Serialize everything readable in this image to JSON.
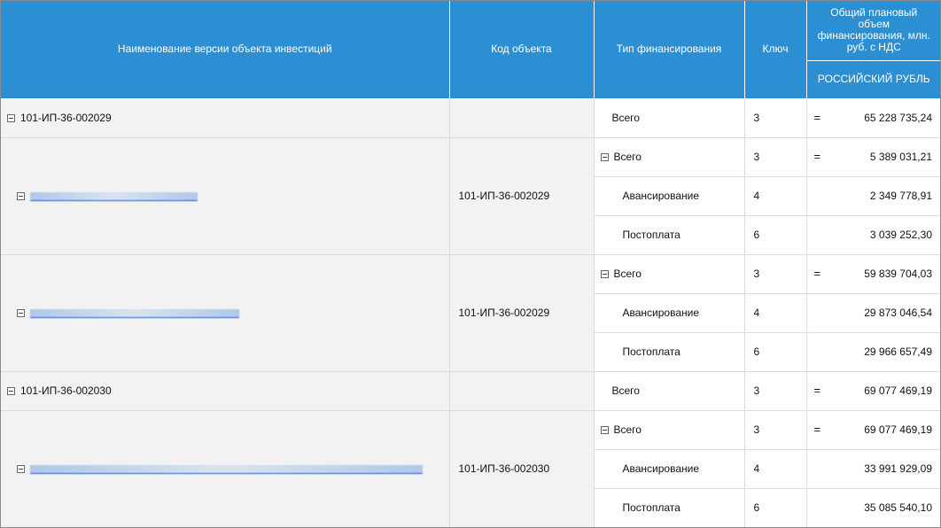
{
  "header": {
    "name": "Наименование версии объекта инвестиций",
    "code": "Код объекта",
    "type": "Тип финансирования",
    "key": "Ключ",
    "total_line1": "Общий плановый",
    "total_line2": "объем",
    "total_line3": "финансирования, млн.",
    "total_line4": "руб. с НДС",
    "currency": "РОССИЙСКИЙ РУБЛЬ"
  },
  "rows": {
    "r1": {
      "name": "101-ИП-36-002029",
      "type": "Всего",
      "key": "3",
      "eq": "=",
      "value": "65 228 735,24"
    },
    "g1": {
      "code": "101-ИП-36-002029",
      "a": {
        "type": "Всего",
        "key": "3",
        "eq": "=",
        "value": "5 389 031,21"
      },
      "b": {
        "type": "Авансирование",
        "key": "4",
        "value": "2 349 778,91"
      },
      "c": {
        "type": "Постоплата",
        "key": "6",
        "value": "3 039 252,30"
      }
    },
    "g2": {
      "code": "101-ИП-36-002029",
      "a": {
        "type": "Всего",
        "key": "3",
        "eq": "=",
        "value": "59 839 704,03"
      },
      "b": {
        "type": "Авансирование",
        "key": "4",
        "value": "29 873 046,54"
      },
      "c": {
        "type": "Постоплата",
        "key": "6",
        "value": "29 966 657,49"
      }
    },
    "r2": {
      "name": "101-ИП-36-002030",
      "type": "Всего",
      "key": "3",
      "eq": "=",
      "value": "69 077 469,19"
    },
    "g3": {
      "code": "101-ИП-36-002030",
      "a": {
        "type": "Всего",
        "key": "3",
        "eq": "=",
        "value": "69 077 469,19"
      },
      "b": {
        "type": "Авансирование",
        "key": "4",
        "value": "33 991 929,09"
      },
      "c": {
        "type": "Постоплата",
        "key": "6",
        "value": "35 085 540,10"
      }
    }
  }
}
